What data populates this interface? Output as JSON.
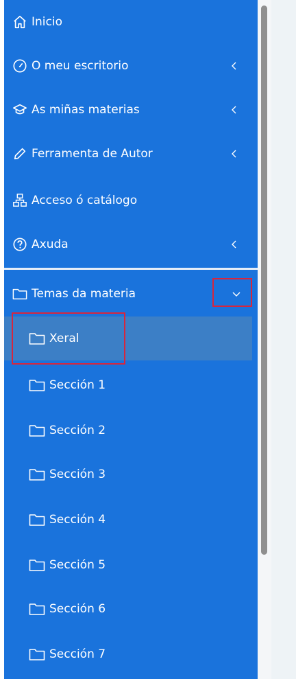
{
  "menu": [
    {
      "label": "Inicio",
      "icon": "home-icon",
      "expandable": false
    },
    {
      "label": "O meu escritorio",
      "icon": "gauge-icon",
      "expandable": true
    },
    {
      "label": "As miñas materias",
      "icon": "graduation-cap-icon",
      "expandable": true
    },
    {
      "label": "Ferramenta de Autor",
      "icon": "pencil-icon",
      "expandable": true
    },
    {
      "label": "Acceso ó catálogo",
      "icon": "sitemap-icon",
      "expandable": false
    },
    {
      "label": "Axuda",
      "icon": "question-circle-icon",
      "expandable": true
    }
  ],
  "topics": {
    "label": "Temas da materia",
    "icon": "folder-icon",
    "expanded": true,
    "items": [
      {
        "label": "Xeral",
        "selected": true
      },
      {
        "label": "Sección 1"
      },
      {
        "label": "Sección 2"
      },
      {
        "label": "Sección 3"
      },
      {
        "label": "Sección 4"
      },
      {
        "label": "Sección 5"
      },
      {
        "label": "Sección 6"
      },
      {
        "label": "Sección 7"
      }
    ]
  },
  "colors": {
    "sidebar": "#1a73dc",
    "selected": "#3c7fc6",
    "highlight": "#d7263d"
  }
}
